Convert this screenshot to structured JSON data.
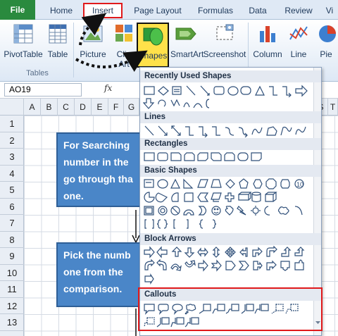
{
  "ribbon_tabs": [
    "File",
    "Home",
    "Insert",
    "Page Layout",
    "Formulas",
    "Data",
    "Review",
    "Vi"
  ],
  "ribbon_buttons": {
    "pivottable": "PivotTable",
    "table": "Table",
    "picture": "Picture",
    "clipart_line1": "Clip",
    "clipart_line2": "Art",
    "shapes": "Shapes",
    "smartart": "SmartArt",
    "screenshot": "Screenshot",
    "column": "Column",
    "line": "Line",
    "pie": "Pie"
  },
  "ribbon_groups": {
    "tables": "Tables"
  },
  "formula_bar": {
    "name_box": "AO19",
    "fx": "fx"
  },
  "columns": [
    "A",
    "B",
    "C",
    "D",
    "E",
    "F",
    "G",
    "S",
    "T"
  ],
  "rows": [
    "1",
    "2",
    "3",
    "4",
    "5",
    "6",
    "7",
    "8",
    "9",
    "10",
    "11",
    "12",
    "13"
  ],
  "flowchart": {
    "box1": "For Searching\nnumber in the\ngo through tha\none.",
    "box2": "Pick the numb\none from the\ncomparison."
  },
  "shapes_menu": {
    "sections": [
      "Recently Used Shapes",
      "Lines",
      "Rectangles",
      "Basic Shapes",
      "Block Arrows",
      "Callouts"
    ]
  },
  "colors": {
    "file_tab": "#2a8a3e",
    "highlight_red": "#e0191b",
    "shapes_button": "#ffe14a",
    "flowbox_fill": "#4a86c8"
  }
}
